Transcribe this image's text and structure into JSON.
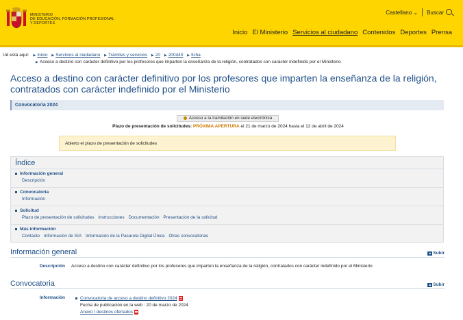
{
  "header": {
    "ministry_lines": [
      "MINISTERIO",
      "DE EDUCACIÓN, FORMACIÓN PROFESIONAL",
      "Y DEPORTES"
    ],
    "language": "Castellano",
    "search_label": "Buscar",
    "nav": [
      "Inicio",
      "El Ministerio",
      "Servicios al ciudadano",
      "Contenidos",
      "Deportes",
      "Prensa"
    ],
    "colors": {
      "band": "#ffd500",
      "accent_line": "#e8b900"
    }
  },
  "breadcrumb": {
    "prefix": "Ud está aquí:",
    "items": [
      "Inicio",
      "Servicios al ciudadano",
      "Trámites y servicios",
      "20",
      "200440",
      "ficha"
    ],
    "current": "Acceso a destino con carácter definitivo por los profesores que imparten la enseñanza de la religión, contratados con carácter indefinido por el Ministerio"
  },
  "page": {
    "title": "Acceso a destino con carácter definitivo por los profesores que imparten la enseñanza de la religión, contratados con carácter indefinido por el Ministerio",
    "convocatoria_bar": "Convocatoria 2024",
    "sede_button": "Acceso a la tramitación en sede electrónica",
    "plazo_label": "Plazo de presentación de solicitudes:",
    "plazo_status": "PRÓXIMA APERTURA",
    "plazo_dates": "el 21 de marzo de 2024 hasta el 12 de abril de 2024",
    "notice": "Abierto el plazo de presentación de solicitudes"
  },
  "indice": {
    "title": "Índice",
    "sections": [
      {
        "head": "Información general",
        "links": [
          "Descripción"
        ]
      },
      {
        "head": "Convocatoria",
        "links": [
          "Información"
        ]
      },
      {
        "head": "Solicitud",
        "links": [
          "Plazo de presentación de solicitudes",
          "Instrucciones",
          "Documentación",
          "Presentación de la solicitud"
        ]
      },
      {
        "head": "Más información",
        "links": [
          "Contacto",
          "Información de SIA",
          "Información de la Pasarela Digital Única",
          "Otras convocatorias"
        ]
      }
    ]
  },
  "info_general": {
    "title": "Información general",
    "subir": "Subir",
    "desc_label": "Descripción",
    "desc_text": "Acceso a destino con carácter definitivo por los profesores que imparten la enseñanza de la religión, contratados con carácter indefinido por el Ministerio"
  },
  "convocatoria": {
    "title": "Convocatoria",
    "subir": "Subir",
    "info_label": "Información",
    "doc_link": "Convocatoria de acceso a destino definitivo 2024",
    "pub_date": "Fecha de publicación en la web : 20 de marzo de 2024",
    "annex_link": "Anexo I destinos ofertados"
  }
}
